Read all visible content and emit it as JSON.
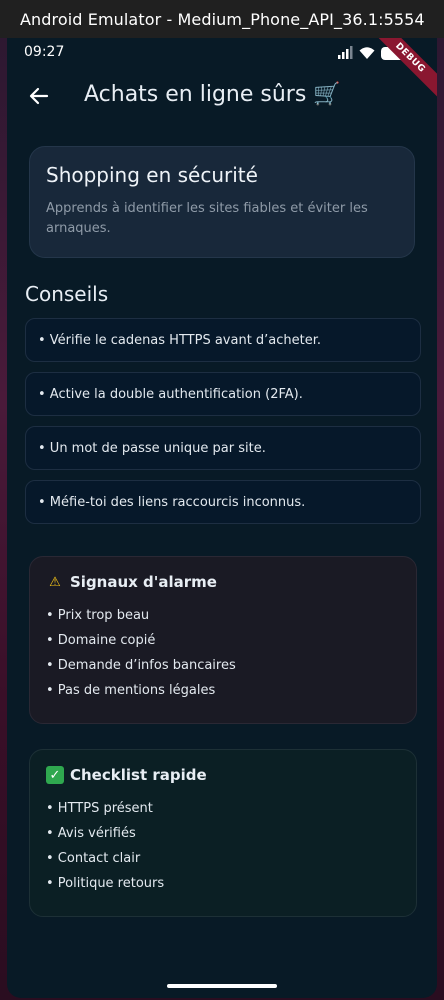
{
  "window": {
    "title": "Android Emulator - Medium_Phone_API_36.1:5554"
  },
  "status_bar": {
    "time": "09:27",
    "icons": [
      "signal-icon",
      "wifi-icon",
      "battery-icon"
    ],
    "debug_label": "DEBUG"
  },
  "app_bar": {
    "back_icon": "arrow-left-icon",
    "title": "Achats en ligne sûrs 🛒"
  },
  "hero": {
    "title": "Shopping en sécurité",
    "subtitle": "Apprends à identifier les sites fiables et éviter les arnaques."
  },
  "tips": {
    "section_title": "Conseils",
    "items": [
      "• Vérifie le cadenas HTTPS avant d’acheter.",
      "• Active la double authentification (2FA).",
      "• Un mot de passe unique par site.",
      "• Méfie-toi des liens raccourcis inconnus."
    ]
  },
  "alarm": {
    "title": "Signaux d'alarme",
    "icon": "warning-icon",
    "items": [
      "• Prix trop beau",
      "• Domaine copié",
      "• Demande d’infos bancaires",
      "• Pas de mentions légales"
    ]
  },
  "checklist": {
    "title": "Checklist rapide",
    "icon": "check-mark-icon",
    "items": [
      "• HTTPS présent",
      "• Avis vérifiés",
      "• Contact clair",
      "• Politique retours"
    ]
  },
  "colors": {
    "background": "#081a26",
    "card": "#18283a",
    "alarm_card": "#1a1a24",
    "check_card": "#0b1f24",
    "debug_banner": "#8a1730"
  }
}
